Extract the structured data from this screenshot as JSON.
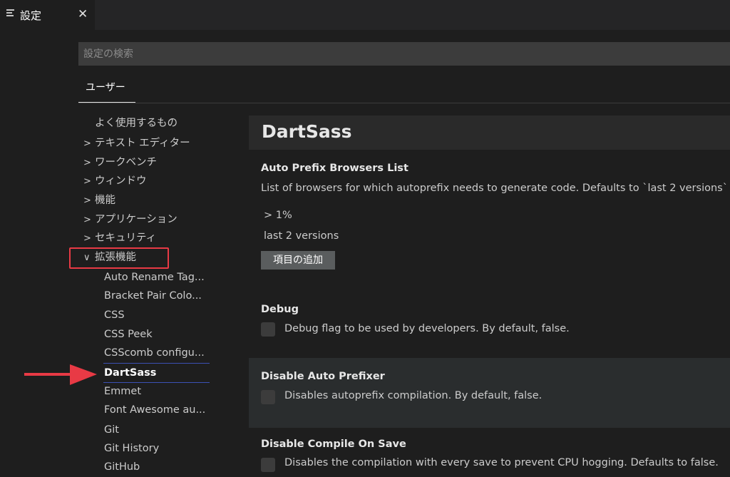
{
  "tab": {
    "icon": "settings-list-icon",
    "label": "設定",
    "close": "✕"
  },
  "search": {
    "placeholder": "設定の検索"
  },
  "scope_tab": "ユーザー",
  "toc": {
    "top_items": [
      {
        "label": "よく使用するもの",
        "chevron": ""
      },
      {
        "label": "テキスト エディター",
        "chevron": ">"
      },
      {
        "label": "ワークベンチ",
        "chevron": ">"
      },
      {
        "label": "ウィンドウ",
        "chevron": ">"
      },
      {
        "label": "機能",
        "chevron": ">"
      },
      {
        "label": "アプリケーション",
        "chevron": ">"
      },
      {
        "label": "セキュリティ",
        "chevron": ">"
      },
      {
        "label": "拡張機能",
        "chevron": "∨"
      }
    ],
    "extensions": [
      "Auto Rename Tag...",
      "Bracket Pair Colo...",
      "CSS",
      "CSS Peek",
      "CSScomb configu...",
      "DartSass",
      "Emmet",
      "Font Awesome au...",
      "Git",
      "Git History",
      "GitHub"
    ],
    "selected": "DartSass"
  },
  "section_title": "DartSass",
  "settings": {
    "auto_prefix": {
      "title": "Auto Prefix Browsers List",
      "description": "List of browsers for which autoprefix needs to generate code. Defaults to `last 2 versions`",
      "values": [
        "> 1%",
        "last 2 versions"
      ],
      "add_button": "項目の追加"
    },
    "debug": {
      "title": "Debug",
      "description": "Debug flag to be used by developers. By default, false.",
      "checked": false
    },
    "disable_auto_prefixer": {
      "title": "Disable Auto Prefixer",
      "description": "Disables autoprefix compilation. By default, false.",
      "checked": false
    },
    "disable_compile_on_save": {
      "title": "Disable Compile On Save",
      "description": "Disables the compilation with every save to prevent CPU hogging. Defaults to false.",
      "checked": false
    }
  },
  "colors": {
    "annotation_red": "#e83a45",
    "selection_line": "#3c50b4"
  }
}
